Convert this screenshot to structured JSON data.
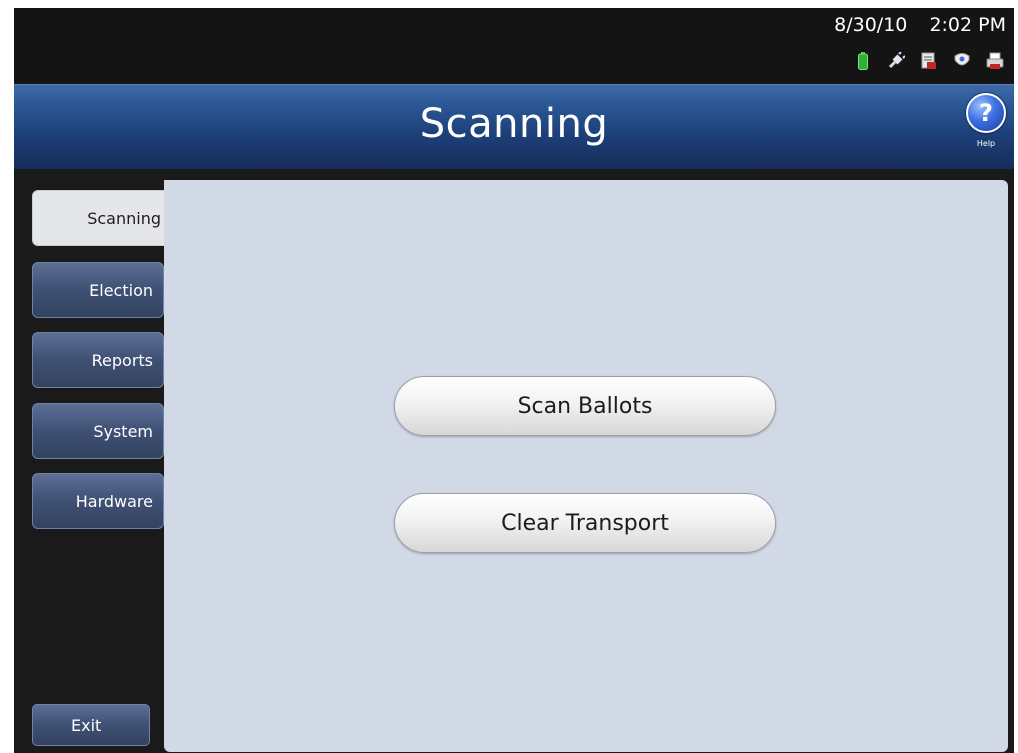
{
  "status": {
    "date": "8/30/10",
    "time": "2:02 PM",
    "icons": [
      "battery-icon",
      "power-plug-icon",
      "document-icon",
      "shield-icon",
      "printer-icon"
    ]
  },
  "header": {
    "title": "Scanning",
    "help_label": "Help",
    "help_glyph": "?"
  },
  "sidebar": {
    "tabs": [
      {
        "label": "Scanning",
        "active": true
      },
      {
        "label": "Election",
        "active": false
      },
      {
        "label": "Reports",
        "active": false
      },
      {
        "label": "System",
        "active": false
      },
      {
        "label": "Hardware",
        "active": false
      }
    ],
    "exit_label": "Exit"
  },
  "main": {
    "buttons": [
      {
        "label": "Scan Ballots"
      },
      {
        "label": "Clear Transport"
      }
    ]
  },
  "colors": {
    "titlebar": "#1d3f78",
    "content_bg": "#d2d9e6",
    "tab_bg": "#3f5075",
    "active_tab_bg": "#e4e6ea"
  }
}
